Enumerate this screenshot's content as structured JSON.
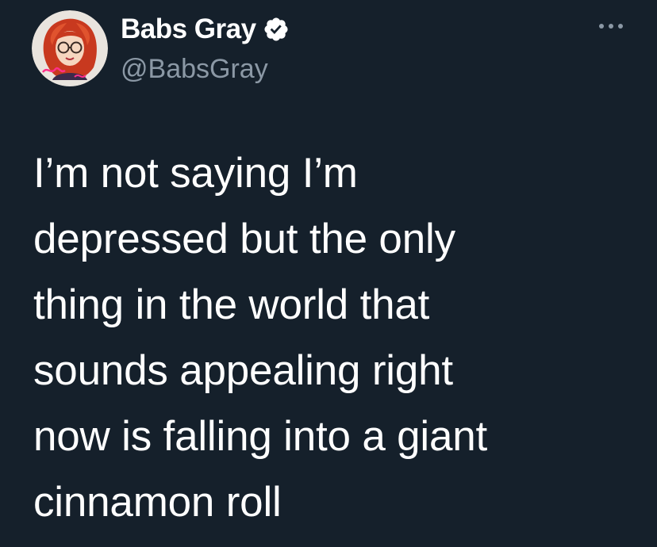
{
  "author": {
    "display_name": "Babs Gray",
    "handle": "@BabsGray",
    "verified": true,
    "avatar_icon": "red-haired-woman-with-glasses-avatar"
  },
  "tweet": {
    "text": "I’m not saying I’m\ndepressed but the only\nthing in the world that\nsounds appealing right\nnow is falling into a giant\ncinnamon roll"
  },
  "menu": {
    "icon": "more-options-icon"
  },
  "colors": {
    "background": "#15202b",
    "text_primary": "#ffffff",
    "text_secondary": "#8b98a5",
    "verified_badge": "#ffffff"
  }
}
